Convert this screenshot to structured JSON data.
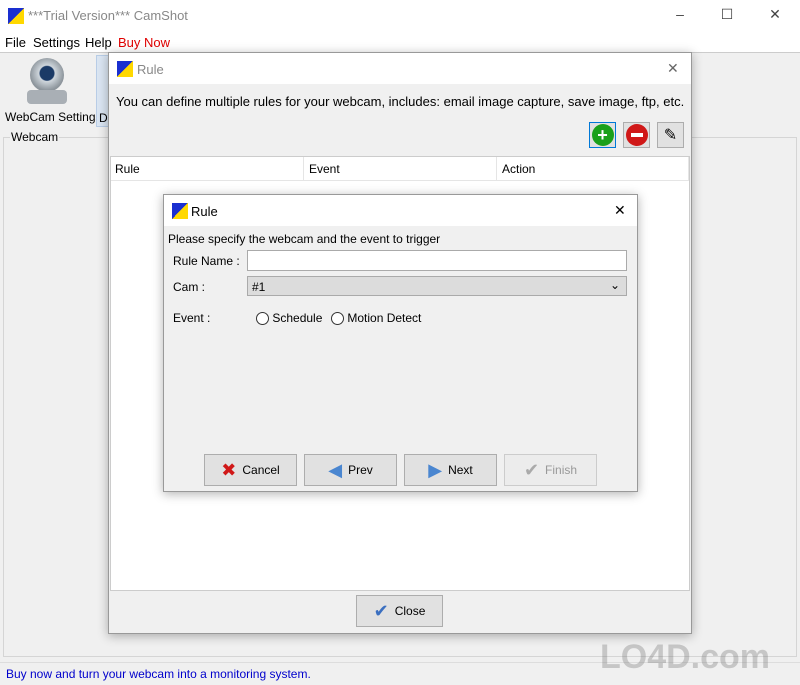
{
  "window": {
    "title": "***Trial Version*** CamShot",
    "minimize": "–",
    "maximize": "☐",
    "close": "✕"
  },
  "menu": [
    "File",
    "Settings",
    "Help",
    "Buy Now"
  ],
  "colors": {
    "buy_now": "#e00000",
    "status_text": "#0000cc",
    "add": "#1aa01a",
    "remove": "#d01818"
  },
  "toolbar": {
    "webcam_settings": "WebCam Settings",
    "partial_button": "De"
  },
  "group": {
    "webcam": "Webcam"
  },
  "status": "Buy now and turn your webcam into a monitoring system.",
  "rule_dialog": {
    "title": "Rule",
    "description": "You can define multiple rules for your webcam, includes: email image capture, save image, ftp, etc.",
    "columns": [
      "Rule",
      "Event",
      "Action"
    ],
    "close_button": "Close",
    "icons": [
      "add-icon",
      "remove-icon",
      "edit-icon"
    ]
  },
  "wizard": {
    "title": "Rule",
    "instruction": "Please specify the webcam and the event to trigger",
    "rule_name_label": "Rule Name :",
    "rule_name_value": "",
    "cam_label": "Cam :",
    "cam_value": "#1",
    "event_label": "Event :",
    "event_options": [
      "Schedule",
      "Motion Detect"
    ],
    "buttons": {
      "cancel": "Cancel",
      "prev": "Prev",
      "next": "Next",
      "finish": "Finish"
    }
  },
  "watermark": "LO4D.com"
}
